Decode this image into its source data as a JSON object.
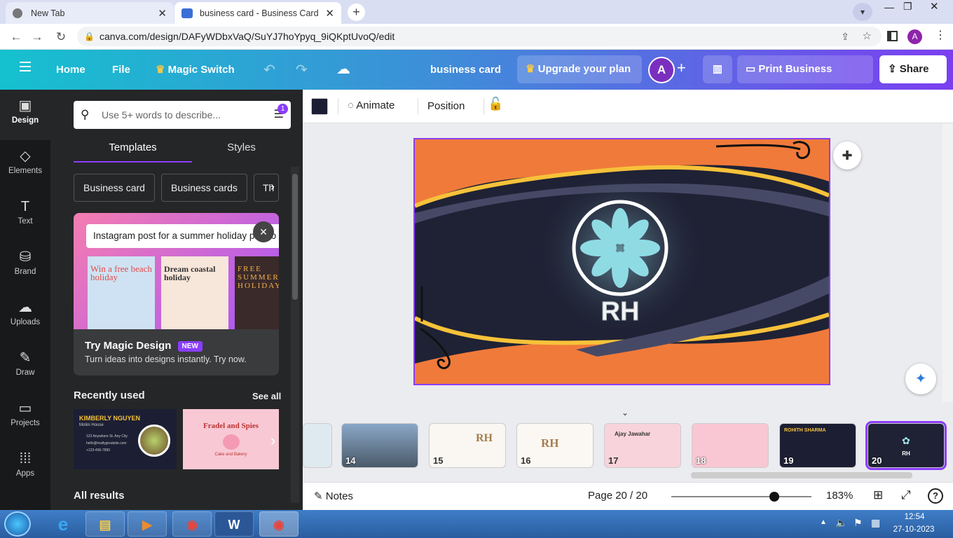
{
  "browser": {
    "tabs": [
      {
        "label": "New Tab"
      },
      {
        "label": "business card - Business Card"
      }
    ],
    "url": "canva.com/design/DAFyWDbxVaQ/SuYJ7hoYpyq_9iQKptUvoQ/edit",
    "profile_initial": "A"
  },
  "header": {
    "home": "Home",
    "file": "File",
    "magic_switch": "Magic Switch",
    "doc_title": "business card",
    "upgrade": "Upgrade your plan",
    "avatar_initial": "A",
    "print": "Print Business Cards",
    "share": "Share",
    "colors": {
      "accent": "#8b3dff",
      "teal": "#15c1cf"
    }
  },
  "rail": [
    {
      "label": "Design",
      "icon": "design-icon"
    },
    {
      "label": "Elements",
      "icon": "elements-icon"
    },
    {
      "label": "Text",
      "icon": "text-icon"
    },
    {
      "label": "Brand",
      "icon": "brand-icon"
    },
    {
      "label": "Uploads",
      "icon": "uploads-icon"
    },
    {
      "label": "Draw",
      "icon": "draw-icon"
    },
    {
      "label": "Projects",
      "icon": "projects-icon"
    },
    {
      "label": "Apps",
      "icon": "apps-icon"
    }
  ],
  "panel": {
    "search_placeholder": "Use 5+ words to describe...",
    "filter_badge": "1",
    "tabs": [
      "Templates",
      "Styles"
    ],
    "chips": [
      "Business card",
      "Business cards",
      "Th"
    ],
    "magic": {
      "prompt": "Instagram post for a summer holiday promo",
      "title": "Try Magic Design",
      "badge": "NEW",
      "subtitle": "Turn ideas into designs instantly. Try now.",
      "thumb_texts": [
        "Win a free beach holiday",
        "Dream coastal holiday",
        "FREE SUMMER HOLIDAY"
      ]
    },
    "recent_title": "Recently used",
    "see_all": "See all",
    "recent": [
      {
        "name": "KIMBERLY NGUYEN",
        "sub": "Molini House",
        "lines": [
          "123 Anywhere St. Any City",
          "hello@reallygreatsite.com",
          "+123-456-7890"
        ]
      },
      {
        "name": "Fradel and Spies",
        "sub": "Cake and Bakery"
      }
    ],
    "all_results": "All results"
  },
  "context": {
    "animate": "Animate",
    "position": "Position",
    "swatch_color": "#1c1f33"
  },
  "canvas": {
    "monogram": "RH",
    "colors": {
      "navy": "#1f2235",
      "orange": "#f07a3a",
      "gold": "#f7c23a"
    }
  },
  "thumbnails": [
    {
      "num": "14"
    },
    {
      "num": "15",
      "mono": "RH"
    },
    {
      "num": "16",
      "mono": "RH"
    },
    {
      "num": "17",
      "name": "Ajay Jawahar"
    },
    {
      "num": "18"
    },
    {
      "num": "19",
      "name": "ROHITH SHARMA"
    },
    {
      "num": "20",
      "mono": "RH"
    }
  ],
  "footer": {
    "notes": "Notes",
    "page": "Page 20 / 20",
    "zoom": "183%"
  },
  "taskbar": {
    "time": "12:54",
    "date": "27-10-2023"
  }
}
